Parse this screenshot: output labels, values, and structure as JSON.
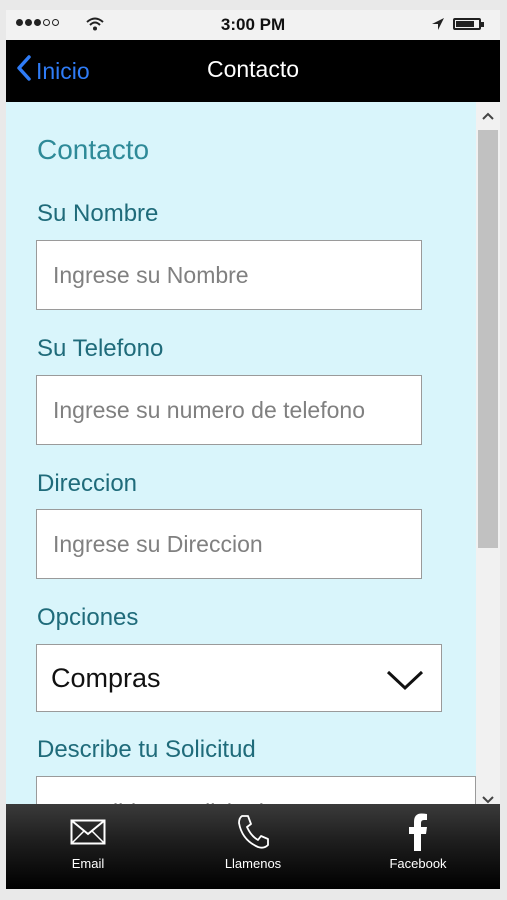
{
  "status_bar": {
    "time": "3:00 PM"
  },
  "nav": {
    "back_label": "Inicio",
    "title": "Contacto"
  },
  "form": {
    "heading": "Contacto",
    "name_label": "Su Nombre",
    "name_placeholder": "Ingrese su Nombre",
    "phone_label": "Su Telefono",
    "phone_placeholder": "Ingrese su numero de telefono",
    "address_label": "Direccion",
    "address_placeholder": "Ingrese su Direccion",
    "options_label": "Opciones",
    "options_selected": "Compras",
    "request_label": "Describe tu Solicitud",
    "request_placeholder": "Describir su solicitud"
  },
  "tabbar": {
    "items": [
      {
        "label": "Email",
        "icon": "envelope-icon"
      },
      {
        "label": "Llamenos",
        "icon": "phone-icon"
      },
      {
        "label": "Facebook",
        "icon": "facebook-icon"
      }
    ]
  },
  "colors": {
    "content_bg": "#d9f5fb",
    "heading": "#2e8a98",
    "label": "#1f6b7a",
    "back_link": "#2f7cf6"
  }
}
